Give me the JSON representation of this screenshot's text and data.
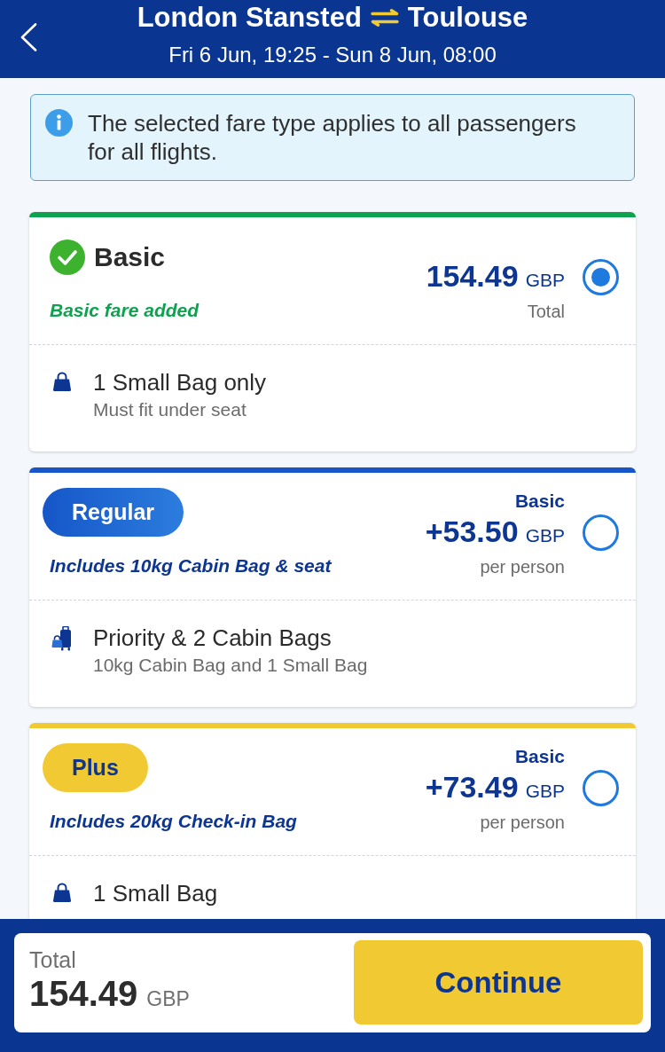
{
  "header": {
    "origin": "London Stansted",
    "destination": "Toulouse",
    "dates": "Fri 6 Jun, 19:25 - Sun 8 Jun, 08:00"
  },
  "info": {
    "text": "The selected fare type applies to all passengers for all flights."
  },
  "fares": [
    {
      "name": "Basic",
      "kind": "added",
      "color": "#0da34e",
      "tagline": "Basic fare added",
      "price": "154.49",
      "currency": "GBP",
      "price_note": "Total",
      "selected": true,
      "features": [
        {
          "kind": "small_bag",
          "title": "1 Small Bag only",
          "detail": "Must fit under seat"
        }
      ]
    },
    {
      "name": "Regular",
      "kind": "badge",
      "color": "#1656c8",
      "tagline": "Includes 10kg Cabin Bag & seat",
      "price_base": "Basic",
      "price": "+53.50",
      "currency": "GBP",
      "price_note": "per person",
      "selected": false,
      "features": [
        {
          "kind": "cabin_bags",
          "title": "Priority & 2 Cabin Bags",
          "detail": "10kg Cabin Bag and 1 Small Bag"
        }
      ]
    },
    {
      "name": "Plus",
      "kind": "badge",
      "color": "#f1c933",
      "tagline": "Includes 20kg Check-in Bag",
      "price_base": "Basic",
      "price": "+73.49",
      "currency": "GBP",
      "price_note": "per person",
      "selected": false,
      "features": [
        {
          "kind": "small_bag",
          "title": "1 Small Bag"
        }
      ]
    }
  ],
  "footer": {
    "total_label": "Total",
    "total_price": "154.49",
    "currency": "GBP",
    "button": "Continue"
  }
}
